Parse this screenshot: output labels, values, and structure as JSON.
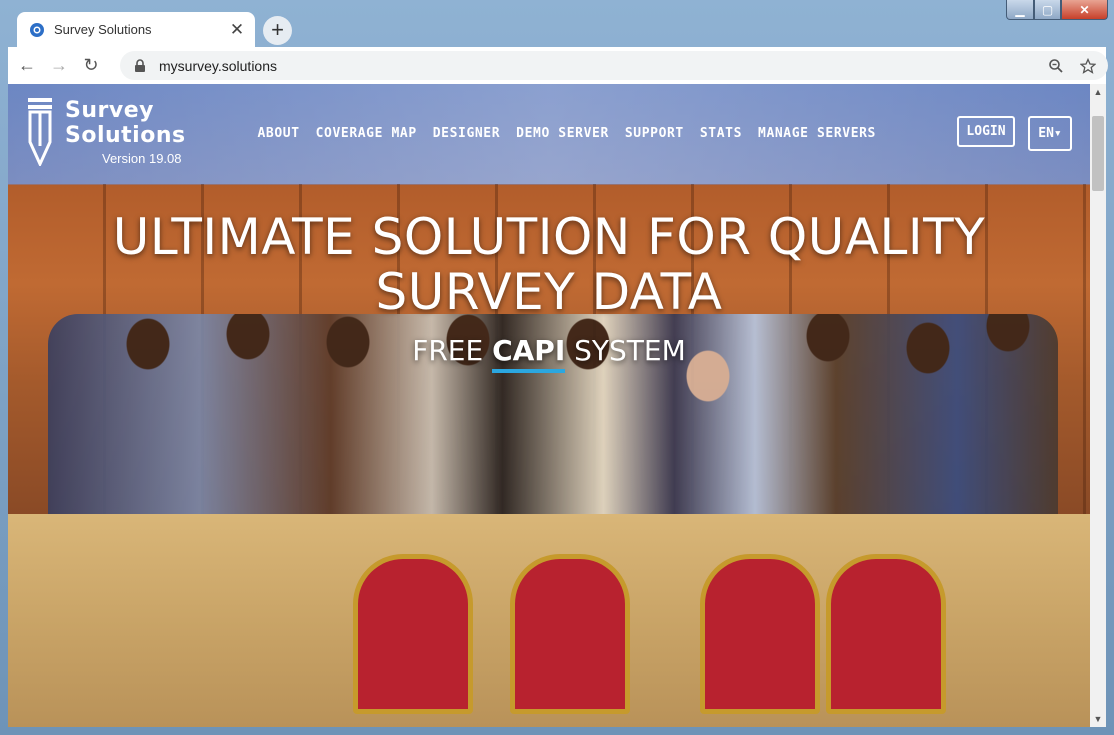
{
  "window": {
    "minimize": "▁",
    "maximize": "▢",
    "close": "✕"
  },
  "tab": {
    "title": "Survey Solutions",
    "close": "✕",
    "new_tab": "+"
  },
  "toolbar": {
    "back": "←",
    "forward": "→",
    "reload": "↻",
    "url": "mysurvey.solutions",
    "zoom_icon": "zoom-out-icon",
    "star_icon": "star-icon"
  },
  "header": {
    "brand_line1": "Survey",
    "brand_line2": "Solutions",
    "version": "Version 19.08",
    "nav": [
      "ABOUT",
      "COVERAGE MAP",
      "DESIGNER",
      "DEMO SERVER",
      "SUPPORT",
      "STATS",
      "MANAGE SERVERS"
    ],
    "login": "LOGIN",
    "language": "EN▾"
  },
  "hero": {
    "title": "ULTIMATE SOLUTION FOR QUALITY SURVEY DATA",
    "sub_prefix": "FREE",
    "sub_strong": "CAPI",
    "sub_suffix": "SYSTEM"
  },
  "colors": {
    "accent_underline": "#2ba7e0",
    "header_overlay": "#6a8fd0"
  }
}
